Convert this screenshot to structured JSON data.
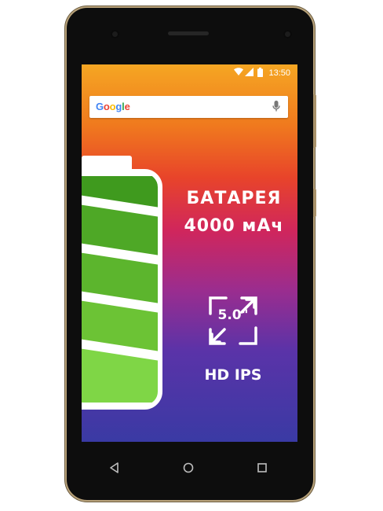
{
  "status_bar": {
    "time": "13:50"
  },
  "search": {
    "logo": "Google",
    "logo_colors": [
      "#4285F4",
      "#EA4335",
      "#FBBC05",
      "#4285F4",
      "#34A853",
      "#EA4335"
    ]
  },
  "promo": {
    "battery_title": "БАТАРЕЯ",
    "battery_capacity": "4000 мАч",
    "screen_size": "5.0\"",
    "display_type": "HD IPS"
  },
  "nav": {
    "back_icon": "back-triangle-icon",
    "home_icon": "home-circle-icon",
    "recents_icon": "recents-square-icon"
  },
  "colors": {
    "battery_cell_dark": "#3f9a1e",
    "battery_cell_light": "#7fd646",
    "frame_gold": "#b8a27a"
  }
}
